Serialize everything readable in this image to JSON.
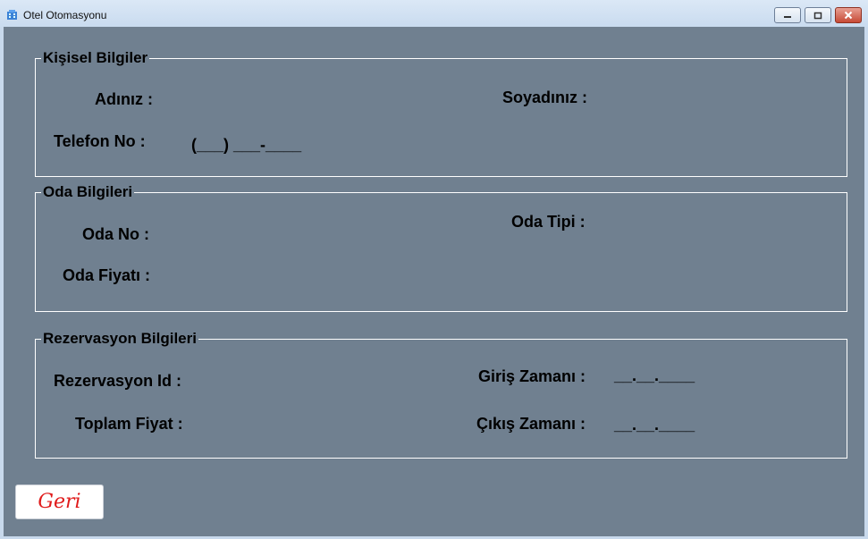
{
  "window": {
    "title": "Otel Otomasyonu",
    "icon": "hotel-building-icon",
    "buttons": {
      "minimize": "minimize-icon",
      "maximize": "maximize-icon",
      "close": "close-icon"
    }
  },
  "colors": {
    "client_bg": "#708090",
    "button_text": "#e01b1b",
    "group_border": "#ffffff"
  },
  "kisisel": {
    "legend": "Kişisel Bilgiler",
    "ad_label": "Adınız :",
    "soyad_label": "Soyadınız :",
    "telefon_label": "Telefon No :",
    "telefon_mask": "(___) ___-____"
  },
  "oda": {
    "legend": "Oda Bilgileri",
    "no_label": "Oda No :",
    "tip_label": "Oda Tipi :",
    "fiyat_label": "Oda Fiyatı :"
  },
  "rezervasyon": {
    "legend": "Rezervasyon Bilgileri",
    "id_label": "Rezervasyon Id :",
    "toplam_label": "Toplam Fiyat :",
    "giris_label": "Giriş Zamanı :",
    "giris_mask": "__.__.____",
    "cikis_label": "Çıkış Zamanı :",
    "cikis_mask": "__.__.____"
  },
  "geri_button": "Geri"
}
